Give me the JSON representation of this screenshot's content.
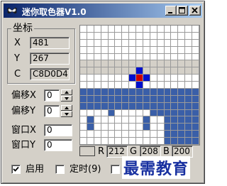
{
  "window": {
    "title": "迷你取色器V1.0"
  },
  "coords_group": {
    "title": "坐标",
    "x_label": "X",
    "x_value": "481",
    "y_label": "Y",
    "y_value": "267",
    "c_label": "C",
    "c_value": "C8D0D4"
  },
  "offset": {
    "x_label": "偏移X",
    "x_value": "0",
    "y_label": "偏移Y",
    "y_value": "0"
  },
  "window_pos": {
    "x_label": "窗口X",
    "x_value": "0",
    "y_label": "窗口Y",
    "y_value": "0"
  },
  "rgb": {
    "r_label": "R",
    "r_value": "212",
    "g_label": "G",
    "g_value": "208",
    "b_label": "B",
    "b_value": "200"
  },
  "options": {
    "enable_label": "启用",
    "enable_checked": true,
    "timer_label": "定时(9)",
    "timer_checked": false,
    "third_checked": false
  },
  "watermark": "最需教育",
  "colors": {
    "title_start": "#0a246a",
    "title_end": "#a6caf0",
    "gray": "#d4d0c8",
    "white": "#ffffff",
    "blue": "#3a5fa8",
    "center": "#cc0000",
    "cross": "#0010cc"
  },
  "magnifier": {
    "rows": [
      "WWWWWWWWWWWWWWWWW",
      "WWWWWWWWWWWWWWWWW",
      "WWWWWWWWWWWWWWWWW",
      "WWWWWWWWWWWWWWWWW",
      "WWWWWWWWWWWWWWWWW",
      "GGGGGGGGGGGGGGGGG",
      "GGGGGGGGXGGGGGGGG",
      "WWWWWWWXCXWWWWWWW",
      "WWWWWWWWXWWWWWWWW",
      "BBBBBBBBBBBBBBBBB",
      "BBBBBBBBBBBBBBBBB",
      "BBBBBBBBBBBBBBBBB",
      "WWWWBWWWWWBBBBBBB",
      "WBWWWWWWWBWWBBBBB",
      "WBWWWWWWWBWWBBBBB",
      "WWWWWWWWWWWWBBBBB",
      "WWWWWWWWWWWWBBBBB"
    ]
  }
}
